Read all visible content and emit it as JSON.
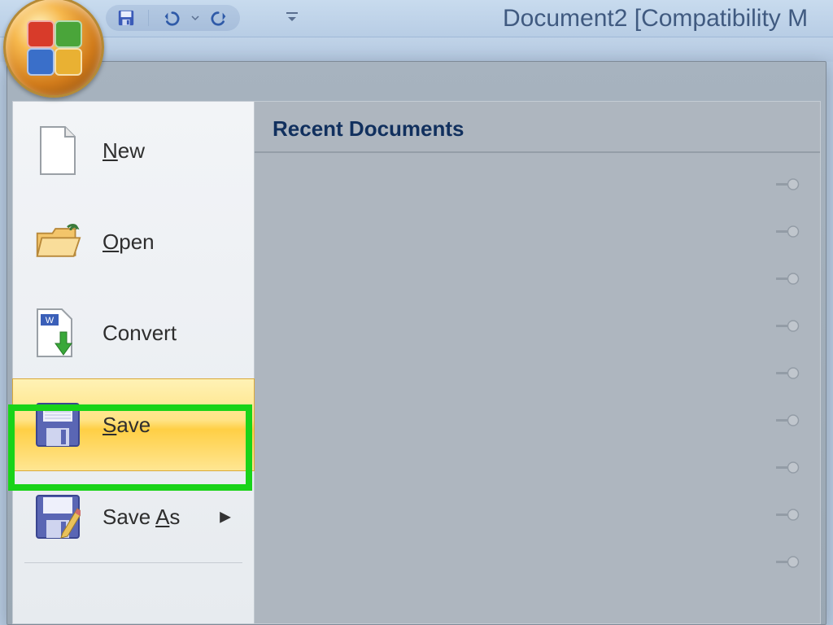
{
  "titlebar": {
    "document_title": "Document2 [Compatibility M"
  },
  "qat": {
    "save_tip": "Save",
    "undo_tip": "Undo",
    "redo_tip": "Redo"
  },
  "menu": {
    "new_label": "New",
    "open_label": "Open",
    "convert_label": "Convert",
    "save_label": "Save",
    "save_as_label": "Save As"
  },
  "recent": {
    "heading": "Recent Documents",
    "rows": 9
  }
}
